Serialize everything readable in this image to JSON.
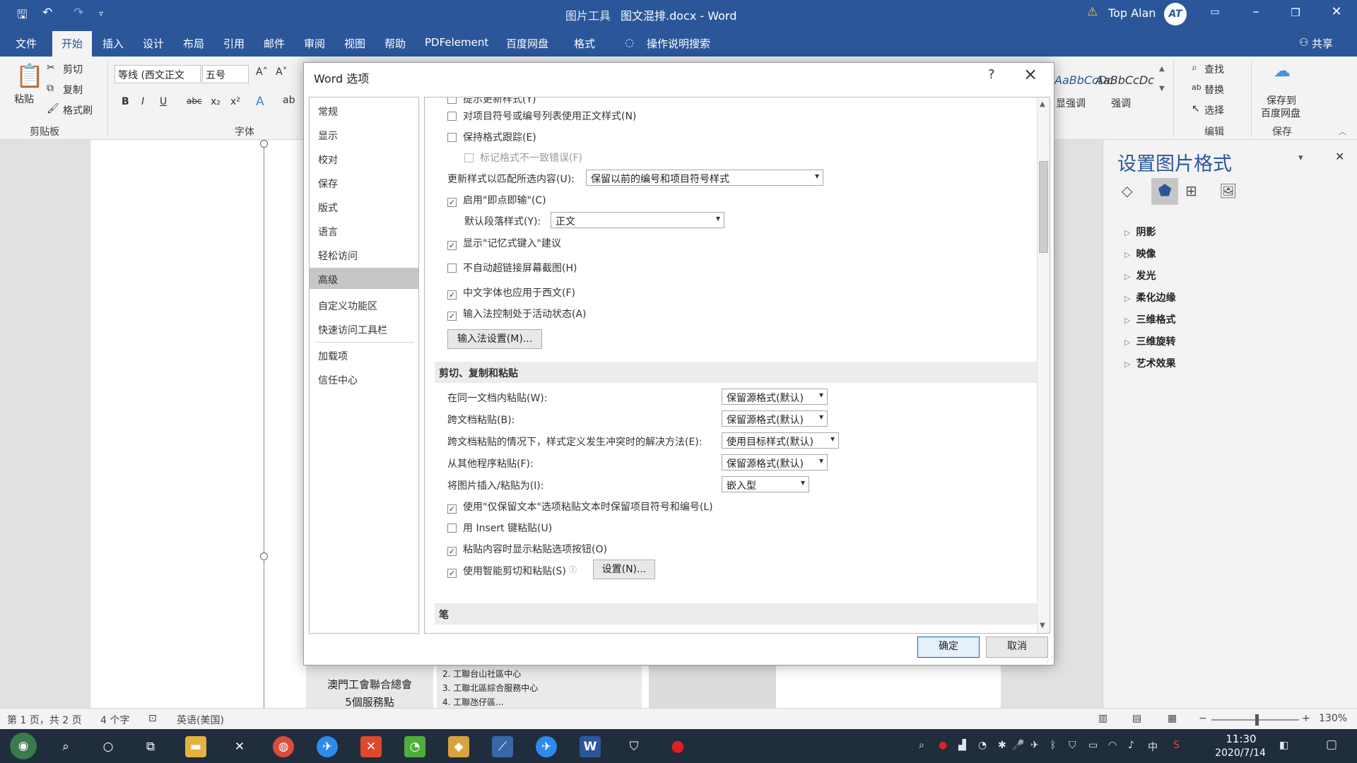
{
  "titlebar": {
    "context_label": "图片工具",
    "doc_title": "图文混排.docx  -  Word",
    "user_name": "Top Alan",
    "avatar_initials": "AT"
  },
  "tabs": [
    {
      "label": "文件"
    },
    {
      "label": "开始"
    },
    {
      "label": "插入"
    },
    {
      "label": "设计"
    },
    {
      "label": "布局"
    },
    {
      "label": "引用"
    },
    {
      "label": "邮件"
    },
    {
      "label": "审阅"
    },
    {
      "label": "视图"
    },
    {
      "label": "帮助"
    },
    {
      "label": "PDFelement"
    },
    {
      "label": "百度网盘"
    },
    {
      "label": "格式"
    }
  ],
  "tell_me": "操作说明搜索",
  "share": "共享",
  "ribbon": {
    "paste": "粘贴",
    "cut": "剪切",
    "copy": "复制",
    "format_painter": "格式刷",
    "clipboard_group": "剪贴板",
    "font_name": "等线 (西文正文",
    "font_size": "五号",
    "font_group": "字体",
    "style1": "AaBbCcDc",
    "style1_label": "显强调",
    "style2": "AaBbCcDc",
    "style2_label": "强调",
    "find": "查找",
    "replace": "替换",
    "select": "选择",
    "edit_group": "编辑",
    "save_baidu_1": "保存到",
    "save_baidu_2": "百度网盘",
    "save_group": "保存"
  },
  "pane": {
    "title": "设置图片格式",
    "items": [
      "阴影",
      "映像",
      "发光",
      "柔化边缘",
      "三维格式",
      "三维旋转",
      "艺术效果"
    ]
  },
  "dialog": {
    "title": "Word 选项",
    "help": "?",
    "nav": [
      "常规",
      "显示",
      "校对",
      "保存",
      "版式",
      "语言",
      "轻松访问",
      "高级",
      "自定义功能区",
      "快速访问工具栏",
      "加载项",
      "信任中心"
    ],
    "opts": {
      "o0": "提示更新样式(Y)",
      "o1": "对项目符号或编号列表使用正文样式(N)",
      "o2": "保持格式跟踪(E)",
      "o3": "标记格式不一致错误(F)",
      "update_label": "更新样式以匹配所选内容(U):",
      "update_value": "保留以前的编号和项目符号样式",
      "o4": "启用\"即点即输\"(C)",
      "default_para_label": "默认段落样式(Y):",
      "default_para_value": "正文",
      "o5": "显示\"记忆式键入\"建议",
      "o6": "不自动超链接屏幕截图(H)",
      "o7": "中文字体也应用于西文(F)",
      "o8": "输入法控制处于活动状态(A)",
      "ime_btn": "输入法设置(M)...",
      "sec_cut": "剪切、复制和粘贴",
      "p1_label": "在同一文档内粘贴(W):",
      "p1_value": "保留源格式(默认)",
      "p2_label": "跨文档粘贴(B):",
      "p2_value": "保留源格式(默认)",
      "p3_label": "跨文档粘贴的情况下，样式定义发生冲突时的解决方法(E):",
      "p3_value": "使用目标样式(默认)",
      "p4_label": "从其他程序粘贴(F):",
      "p4_value": "保留源格式(默认)",
      "p5_label": "将图片插入/粘贴为(I):",
      "p5_value": "嵌入型",
      "o9": "使用\"仅保留文本\"选项粘贴文本时保留项目符号和编号(L)",
      "o10": "用 Insert 键粘贴(U)",
      "o11": "粘贴内容时显示粘贴选项按钮(O)",
      "o12": "使用智能剪切和粘贴(S)",
      "settings_btn": "设置(N)...",
      "sec_pen": "笔"
    },
    "ok": "确定",
    "cancel": "取消"
  },
  "document": {
    "org_line1": "澳門工會聯合總會",
    "org_line2": "5個服務點",
    "rows": [
      "2.  工聯台山社區中心",
      "3.  工聯北區綜合服務中心",
      "4.  工聯氹仔區..."
    ]
  },
  "status": {
    "page": "第 1 页，共 2 页",
    "words": "4 个字",
    "lang": "英语(美国)",
    "zoom": "130%"
  },
  "clock": {
    "time": "11:30",
    "date": "2020/7/14"
  }
}
